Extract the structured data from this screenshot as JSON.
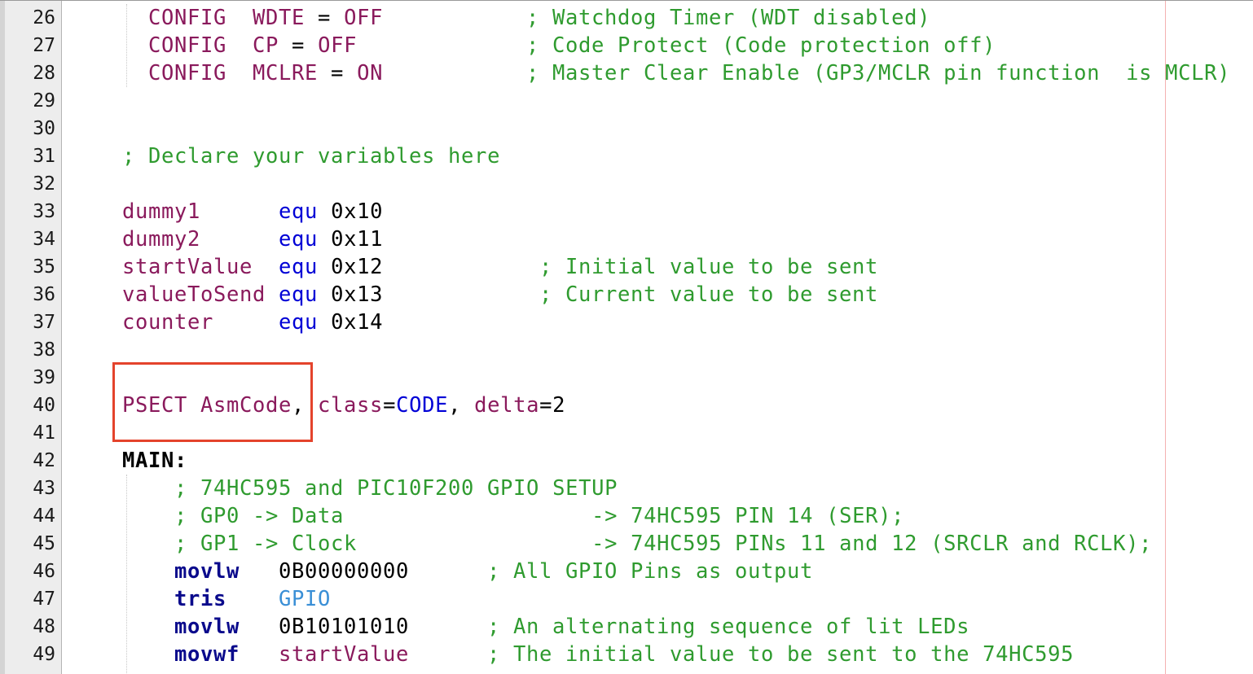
{
  "editor": {
    "lines": [
      {
        "num": "26",
        "parts": [
          [
            "CONFIG",
            "kw"
          ],
          [
            "  ",
            "op"
          ],
          [
            "WDTE",
            "kw"
          ],
          [
            " = ",
            "op"
          ],
          [
            "OFF",
            "kw"
          ],
          [
            "           ",
            "op"
          ],
          [
            "; Watchdog Timer (WDT disabled)",
            "cm"
          ]
        ]
      },
      {
        "num": "27",
        "parts": [
          [
            "CONFIG",
            "kw"
          ],
          [
            "  ",
            "op"
          ],
          [
            "CP",
            "kw"
          ],
          [
            " = ",
            "op"
          ],
          [
            "OFF",
            "kw"
          ],
          [
            "             ",
            "op"
          ],
          [
            "; Code Protect (Code protection off)",
            "cm"
          ]
        ]
      },
      {
        "num": "28",
        "parts": [
          [
            "CONFIG",
            "kw"
          ],
          [
            "  ",
            "op"
          ],
          [
            "MCLRE",
            "kw"
          ],
          [
            " = ",
            "op"
          ],
          [
            "ON",
            "kw"
          ],
          [
            "           ",
            "op"
          ],
          [
            "; Master Clear Enable (GP3/MCLR pin function  is MCLR)",
            "cm"
          ]
        ]
      },
      {
        "num": "29",
        "parts": []
      },
      {
        "num": "30",
        "parts": []
      },
      {
        "num": "31",
        "parts": [
          [
            "; Declare your variables here",
            "cm"
          ]
        ]
      },
      {
        "num": "32",
        "parts": []
      },
      {
        "num": "33",
        "parts": [
          [
            "dummy1",
            "kw"
          ],
          [
            "      ",
            "op"
          ],
          [
            "equ",
            "eq"
          ],
          [
            " ",
            "op"
          ],
          [
            "0x10",
            "num"
          ]
        ]
      },
      {
        "num": "34",
        "parts": [
          [
            "dummy2",
            "kw"
          ],
          [
            "      ",
            "op"
          ],
          [
            "equ",
            "eq"
          ],
          [
            " ",
            "op"
          ],
          [
            "0x11",
            "num"
          ]
        ]
      },
      {
        "num": "35",
        "parts": [
          [
            "startValue",
            "kw"
          ],
          [
            "  ",
            "op"
          ],
          [
            "equ",
            "eq"
          ],
          [
            " ",
            "op"
          ],
          [
            "0x12",
            "num"
          ],
          [
            "            ",
            "op"
          ],
          [
            "; Initial value to be sent",
            "cm"
          ]
        ]
      },
      {
        "num": "36",
        "parts": [
          [
            "valueToSend",
            "kw"
          ],
          [
            " ",
            "op"
          ],
          [
            "equ",
            "eq"
          ],
          [
            " ",
            "op"
          ],
          [
            "0x13",
            "num"
          ],
          [
            "            ",
            "op"
          ],
          [
            "; Current value to be sent",
            "cm"
          ]
        ]
      },
      {
        "num": "37",
        "parts": [
          [
            "counter",
            "kw"
          ],
          [
            "     ",
            "op"
          ],
          [
            "equ",
            "eq"
          ],
          [
            " ",
            "op"
          ],
          [
            "0x14",
            "num"
          ]
        ]
      },
      {
        "num": "38",
        "parts": []
      },
      {
        "num": "39",
        "parts": []
      },
      {
        "num": "40",
        "parts": [
          [
            "PSECT AsmCode",
            "kw"
          ],
          [
            ", ",
            "op"
          ],
          [
            "class",
            "kw"
          ],
          [
            "=",
            "op"
          ],
          [
            "CODE",
            "cd"
          ],
          [
            ", ",
            "op"
          ],
          [
            "delta",
            "kw"
          ],
          [
            "=2",
            "op"
          ]
        ]
      },
      {
        "num": "41",
        "parts": []
      },
      {
        "num": "42",
        "parts": [
          [
            "MAIN:",
            "lbl"
          ]
        ]
      },
      {
        "num": "43",
        "parts": [
          [
            "; 74HC595 and PIC10F200 GPIO SETUP",
            "cm"
          ]
        ]
      },
      {
        "num": "44",
        "parts": [
          [
            "; GP0 -> Data                   -> 74HC595 PIN 14 (SER);",
            "cm"
          ]
        ]
      },
      {
        "num": "45",
        "parts": [
          [
            "; GP1 -> Clock                  -> 74HC595 PINs 11 and 12 (SRCLR and RCLK);",
            "cm"
          ]
        ]
      },
      {
        "num": "46",
        "parts": [
          [
            "movlw",
            "ins"
          ],
          [
            "   ",
            "op"
          ],
          [
            "0B00000000",
            "num"
          ],
          [
            "      ",
            "op"
          ],
          [
            "; All GPIO Pins as output",
            "cm"
          ]
        ]
      },
      {
        "num": "47",
        "parts": [
          [
            "tris",
            "ins"
          ],
          [
            "    ",
            "op"
          ],
          [
            "GPIO",
            "reg"
          ]
        ]
      },
      {
        "num": "48",
        "parts": [
          [
            "movlw",
            "ins"
          ],
          [
            "   ",
            "op"
          ],
          [
            "0B10101010",
            "num"
          ],
          [
            "      ",
            "op"
          ],
          [
            "; An alternating sequence of lit LEDs",
            "cm"
          ]
        ]
      },
      {
        "num": "49",
        "parts": [
          [
            "movwf",
            "ins"
          ],
          [
            "   ",
            "op"
          ],
          [
            "startValue",
            "kw"
          ],
          [
            "      ",
            "op"
          ],
          [
            "; The initial value to be sent to the 74HC595",
            "cm"
          ]
        ]
      }
    ]
  },
  "highlight": {
    "color": "#e4432c"
  }
}
